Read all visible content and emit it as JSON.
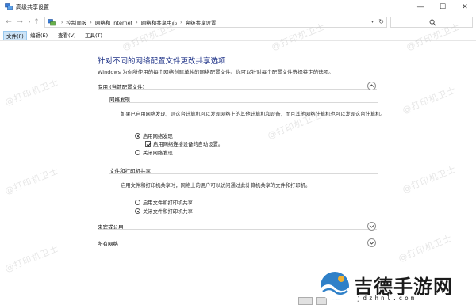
{
  "window": {
    "title": "高级共享设置",
    "controls": {
      "minimize": "—",
      "maximize": "☐",
      "close": "✕"
    }
  },
  "address": {
    "breadcrumb": [
      "控制面板",
      "网络和 Internet",
      "网络和共享中心",
      "高级共享设置"
    ]
  },
  "menu": [
    {
      "label": "文件(F)",
      "active": true
    },
    {
      "label": "编辑(E)"
    },
    {
      "label": "查看(V)"
    },
    {
      "label": "工具(T)"
    }
  ],
  "content": {
    "heading": "针对不同的网络配置文件更改共享选项",
    "description": "Windows 为你所使用的每个网络创建单独的网络配置文件。你可以针对每个配置文件选择特定的选项。",
    "private_profile": {
      "label": "专用 (当前配置文件)",
      "network_discovery": {
        "title": "网络发现",
        "text": "如果已启用网络发现，则这台计算机可以发现网络上的其他计算机和设备，而且其他网络计算机也可以发现这台计算机。",
        "options": {
          "enable": "启用网络发现",
          "auto_setup": "启用网络连接设备的自动设置。",
          "disable": "关闭网络发现"
        }
      },
      "file_printer_sharing": {
        "title": "文件和打印机共享",
        "text": "启用文件和打印机共享时，网络上的用户可以访问通过此计算机共享的文件和打印机。",
        "options": {
          "enable": "启用文件和打印机共享",
          "disable": "关闭文件和打印机共享"
        }
      }
    },
    "guest_public_label": "来宾或公用",
    "all_networks_label": "所有网络"
  },
  "watermark": "@打印机卫士",
  "logo": {
    "text": "吉德手游网",
    "domain": "jdzhnl.com"
  },
  "accent_color": "#1e3287"
}
